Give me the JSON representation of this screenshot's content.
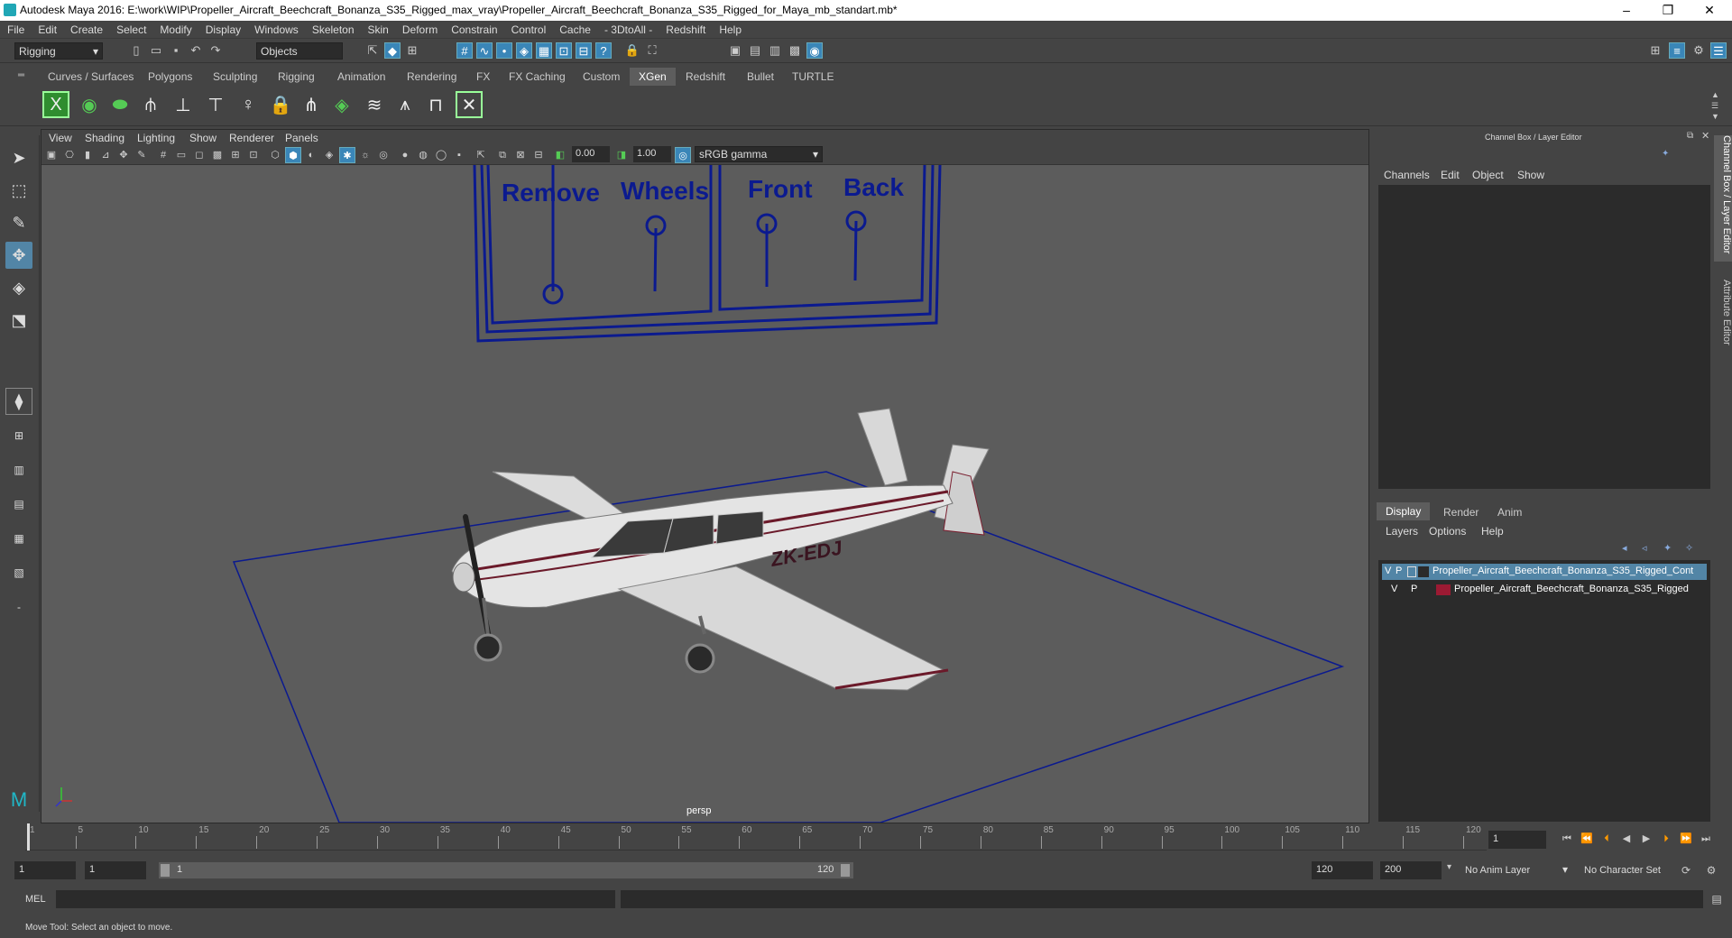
{
  "window": {
    "title": "Autodesk Maya 2016: E:\\work\\WIP\\Propeller_Aircraft_Beechcraft_Bonanza_S35_Rigged_max_vray\\Propeller_Aircraft_Beechcraft_Bonanza_S35_Rigged_for_Maya_mb_standart.mb*",
    "minimize": "–",
    "restore": "❐",
    "close": "✕"
  },
  "menubar": [
    "File",
    "Edit",
    "Create",
    "Select",
    "Modify",
    "Display",
    "Windows",
    "Skeleton",
    "Skin",
    "Deform",
    "Constrain",
    "Control",
    "Cache",
    "- 3DtoAll -",
    "Redshift",
    "Help"
  ],
  "statusline": {
    "mode": "Rigging",
    "selection_mode": "Objects"
  },
  "shelf_tabs": [
    "Curves / Surfaces",
    "Polygons",
    "Sculpting",
    "Rigging",
    "Animation",
    "Rendering",
    "FX",
    "FX Caching",
    "Custom",
    "XGen",
    "Redshift",
    "Bullet",
    "TURTLE"
  ],
  "shelf_active": "XGen",
  "viewport": {
    "menu": [
      "View",
      "Shading",
      "Lighting",
      "Show",
      "Renderer",
      "Panels"
    ],
    "exposure": "0.00",
    "gamma": "1.00",
    "color_space": "sRGB gamma",
    "camera_label": "persp",
    "scene_text": {
      "remove": "Remove",
      "wheels": "Wheels",
      "front": "Front",
      "back": "Back",
      "registration": "ZK-EDJ"
    }
  },
  "channel_box": {
    "title": "Channel Box / Layer Editor",
    "menu": [
      "Channels",
      "Edit",
      "Object",
      "Show"
    ]
  },
  "layer_editor": {
    "tabs": [
      "Display",
      "Render",
      "Anim"
    ],
    "active_tab": "Display",
    "menu": [
      "Layers",
      "Options",
      "Help"
    ],
    "layers": [
      {
        "v": "V",
        "p": "P",
        "name": "Propeller_Aircraft_Beechcraft_Bonanza_S35_Rigged_Cont",
        "color": "#5285a6",
        "selected": true
      },
      {
        "v": "V",
        "p": "P",
        "name": "Propeller_Aircraft_Beechcraft_Bonanza_S35_Rigged",
        "color": "#9c1a33",
        "selected": false
      }
    ]
  },
  "side_tabs": [
    "Channel Box / Layer Editor",
    "Attribute Editor"
  ],
  "timeline": {
    "ticks": [
      "1",
      "5",
      "10",
      "15",
      "20",
      "25",
      "30",
      "35",
      "40",
      "45",
      "50",
      "55",
      "60",
      "65",
      "70",
      "75",
      "80",
      "85",
      "90",
      "95",
      "100",
      "105",
      "110",
      "115",
      "120"
    ],
    "current_frame": "1"
  },
  "range": {
    "start": "1",
    "playback_start": "1",
    "slider_start": "1",
    "slider_end": "120",
    "playback_end": "120",
    "end": "200",
    "anim_layer": "No Anim Layer",
    "character_set": "No Character Set"
  },
  "cmdline": {
    "label": "MEL"
  },
  "helpline": {
    "text": "Move Tool: Select an object to move."
  },
  "colors": {
    "accent": "#5285a6",
    "viewport_bg": "#5c5c5c",
    "rig_lines": "#0b1a8f"
  }
}
